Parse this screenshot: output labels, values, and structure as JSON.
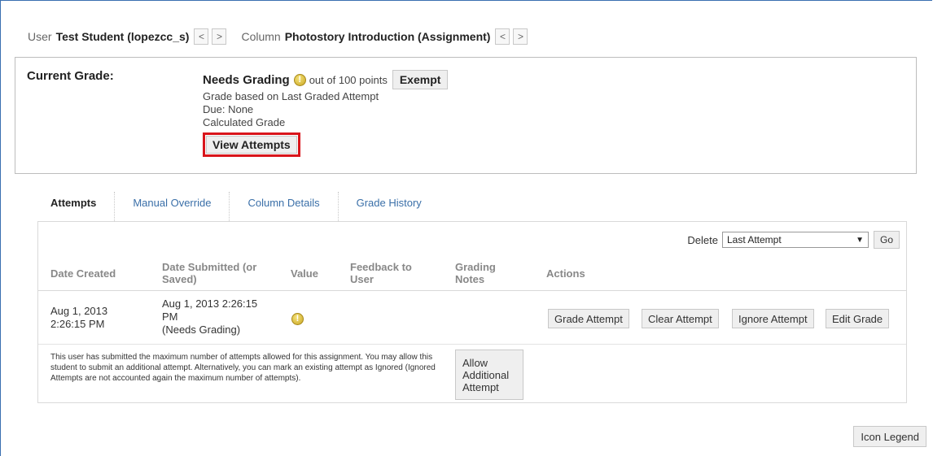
{
  "header": {
    "user_label": "User",
    "user_name": "Test Student (lopezcc_s)",
    "column_label": "Column",
    "column_name": "Photostory Introduction (Assignment)",
    "prev_glyph": "<",
    "next_glyph": ">"
  },
  "current_grade": {
    "label": "Current Grade:",
    "status": "Needs Grading",
    "out_of": "out of 100 points",
    "exempt_label": "Exempt",
    "based_on": "Grade based on Last Graded Attempt",
    "due": "Due: None",
    "calculated": "Calculated Grade",
    "view_attempts_label": "View Attempts",
    "status_icon": "needs-grading-icon",
    "highlight_color": "#d9151b"
  },
  "tabs": [
    {
      "label": "Attempts",
      "active": true
    },
    {
      "label": "Manual Override",
      "active": false
    },
    {
      "label": "Column Details",
      "active": false
    },
    {
      "label": "Grade History",
      "active": false
    }
  ],
  "attempts": {
    "delete_label": "Delete",
    "delete_selected": "Last Attempt",
    "go_label": "Go",
    "columns": [
      "Date Created",
      "Date Submitted (or Saved)",
      "Value",
      "Feedback to User",
      "Grading Notes",
      "Actions"
    ],
    "rows": [
      {
        "date_created": "Aug 1, 2013 2:26:15 PM",
        "date_submitted": "Aug 1, 2013 2:26:15 PM",
        "submitted_status": "(Needs Grading)",
        "value_icon": "needs-grading-icon",
        "feedback": "",
        "notes": ""
      }
    ],
    "actions": [
      "Grade Attempt",
      "Clear Attempt",
      "Ignore Attempt",
      "Edit Grade"
    ],
    "notice": "This user has submitted the maximum number of attempts allowed for this assignment. You may allow this student to submit an additional attempt. Alternatively, you can mark an existing attempt as Ignored (Ignored Attempts are not accounted again the maximum number of attempts).",
    "allow_label": "Allow Additional Attempt"
  },
  "footer": {
    "icon_legend_label": "Icon Legend"
  }
}
